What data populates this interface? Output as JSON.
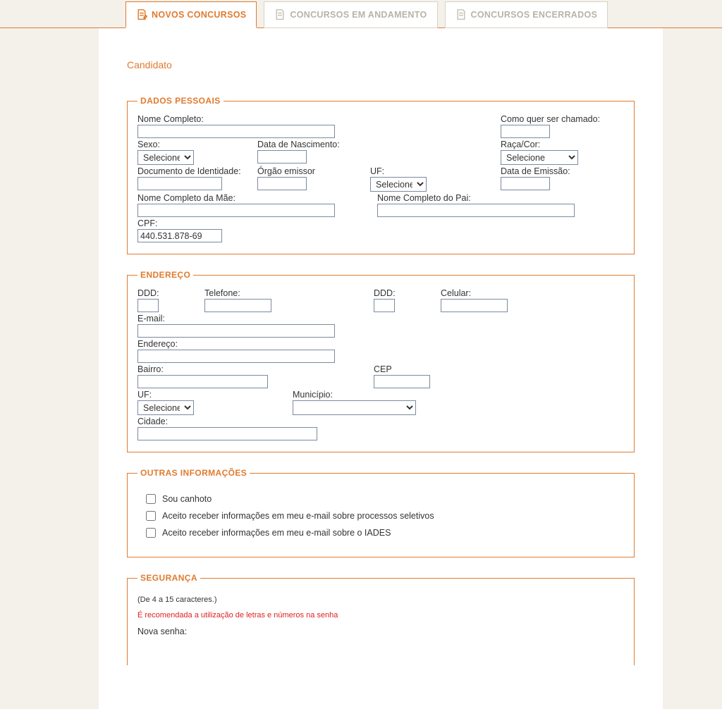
{
  "tabs": {
    "novos": "NOVOS CONCURSOS",
    "andamento": "CONCURSOS EM ANDAMENTO",
    "encerrados": "CONCURSOS ENCERRADOS"
  },
  "page": {
    "title": "Candidato"
  },
  "fieldsets": {
    "dados_pessoais": "DADOS PESSOAIS",
    "endereco": "ENDEREÇO",
    "outras": "OUTRAS INFORMAÇÕES",
    "seguranca": "SEGURANÇA"
  },
  "dados": {
    "nome_label": "Nome Completo:",
    "nome_value": "",
    "apelido_label": "Como quer ser chamado:",
    "apelido_value": "",
    "sexo_label": "Sexo:",
    "sexo_selected": "Selecione",
    "dnasc_label": "Data de Nascimento:",
    "dnasc_value": "",
    "raca_label": "Raça/Cor:",
    "raca_selected": "Selecione",
    "doc_label": "Documento de Identidade:",
    "doc_value": "",
    "orgao_label": "Órgão emissor",
    "orgao_value": "",
    "uf_label": "UF:",
    "uf_selected": "Selecione",
    "emissao_label": "Data de Emissão:",
    "emissao_value": "",
    "mae_label": "Nome Completo da Mãe:",
    "mae_value": "",
    "pai_label": "Nome Completo do Pai:",
    "pai_value": "",
    "cpf_label": "CPF:",
    "cpf_value": "440.531.878-69"
  },
  "endereco": {
    "ddd1_label": "DDD:",
    "ddd1_value": "",
    "tel_label": "Telefone:",
    "tel_value": "",
    "ddd2_label": "DDD:",
    "ddd2_value": "",
    "cel_label": "Celular:",
    "cel_value": "",
    "email_label": "E-mail:",
    "email_value": "",
    "end_label": "Endereço:",
    "end_value": "",
    "bairro_label": "Bairro:",
    "bairro_value": "",
    "cep_label": "CEP",
    "cep_value": "",
    "uf_label": "UF:",
    "uf_selected": "Selecione",
    "municipio_label": "Município:",
    "municipio_selected": "",
    "cidade_label": "Cidade:",
    "cidade_value": ""
  },
  "outras": {
    "canhoto": "Sou canhoto",
    "emails_proc": "Aceito receber informações em meu e-mail sobre processos seletivos",
    "emails_iades": "Aceito receber informações em meu e-mail sobre o IADES"
  },
  "seguranca": {
    "hint": "(De 4 a 15 caracteres.)",
    "warn": "É recomendada a utilização de letras e números na senha",
    "nova_label": "Nova senha:"
  }
}
